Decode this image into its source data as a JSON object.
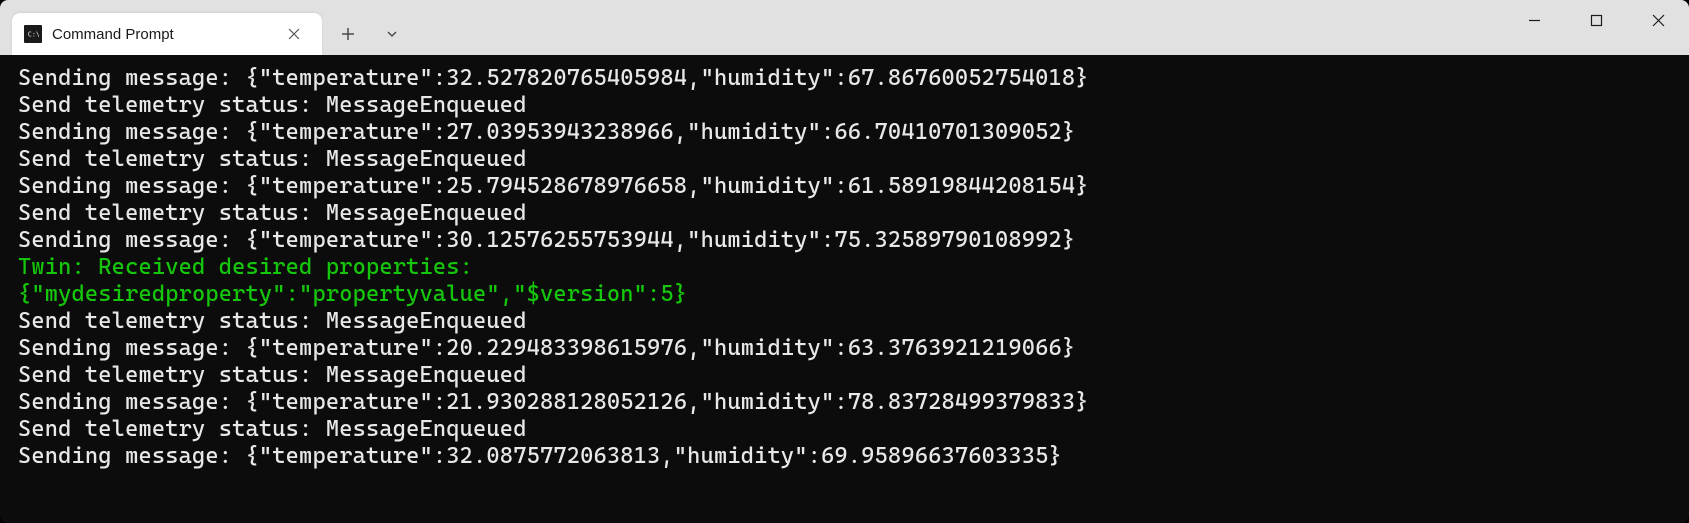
{
  "tab": {
    "title": "Command Prompt"
  },
  "colors": {
    "twin_text": "#16c60c",
    "console_fg": "#e8e8e8",
    "console_bg": "#0c0c0c"
  },
  "lines": [
    {
      "text": "Sending message: {\"temperature\":32.527820765405984,\"humidity\":67.86760052754018}",
      "style": "plain"
    },
    {
      "text": "Send telemetry status: MessageEnqueued",
      "style": "plain"
    },
    {
      "text": "Sending message: {\"temperature\":27.03953943238966,\"humidity\":66.70410701309052}",
      "style": "plain"
    },
    {
      "text": "Send telemetry status: MessageEnqueued",
      "style": "plain"
    },
    {
      "text": "Sending message: {\"temperature\":25.794528678976658,\"humidity\":61.58919844208154}",
      "style": "plain"
    },
    {
      "text": "Send telemetry status: MessageEnqueued",
      "style": "plain"
    },
    {
      "text": "Sending message: {\"temperature\":30.12576255753944,\"humidity\":75.32589790108992}",
      "style": "plain"
    },
    {
      "text": "Twin: Received desired properties:",
      "style": "green"
    },
    {
      "text": "{\"mydesiredproperty\":\"propertyvalue\",\"$version\":5}",
      "style": "green"
    },
    {
      "text": "Send telemetry status: MessageEnqueued",
      "style": "plain"
    },
    {
      "text": "Sending message: {\"temperature\":20.229483398615976,\"humidity\":63.3763921219066}",
      "style": "plain"
    },
    {
      "text": "Send telemetry status: MessageEnqueued",
      "style": "plain"
    },
    {
      "text": "Sending message: {\"temperature\":21.930288128052126,\"humidity\":78.83728499379833}",
      "style": "plain"
    },
    {
      "text": "Send telemetry status: MessageEnqueued",
      "style": "plain"
    },
    {
      "text": "Sending message: {\"temperature\":32.0875772063813,\"humidity\":69.95896637603335}",
      "style": "plain"
    }
  ]
}
